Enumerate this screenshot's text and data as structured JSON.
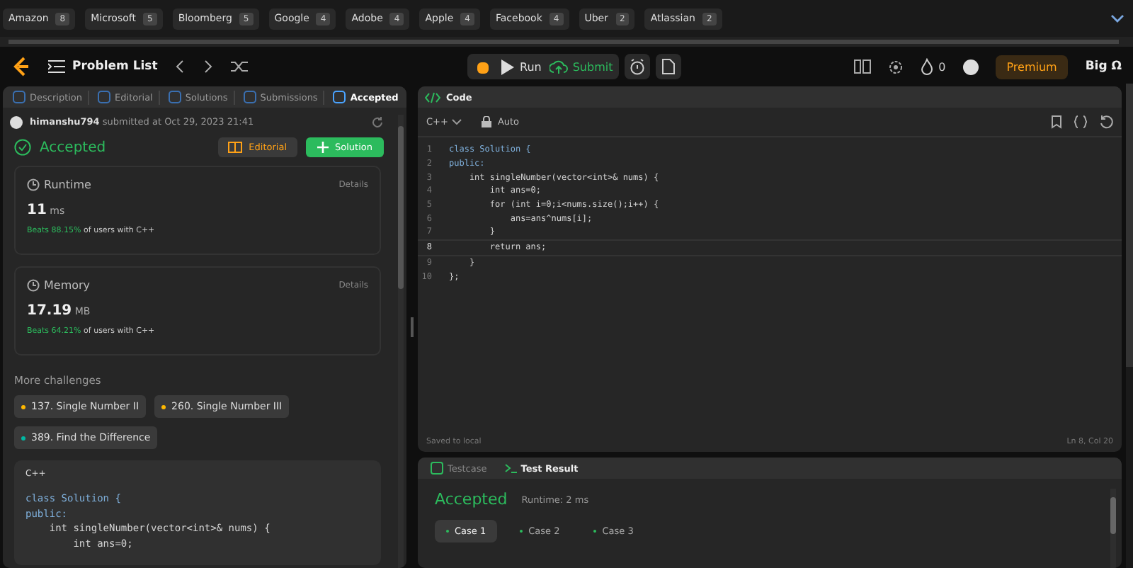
{
  "company_tags": [
    {
      "name": "Amazon",
      "count": "8"
    },
    {
      "name": "Microsoft",
      "count": "5"
    },
    {
      "name": "Bloomberg",
      "count": "5"
    },
    {
      "name": "Google",
      "count": "4"
    },
    {
      "name": "Adobe",
      "count": "4"
    },
    {
      "name": "Apple",
      "count": "4"
    },
    {
      "name": "Facebook",
      "count": "4"
    },
    {
      "name": "Uber",
      "count": "2"
    },
    {
      "name": "Atlassian",
      "count": "2"
    }
  ],
  "navbar": {
    "problem_list": "Problem List",
    "run": "Run",
    "submit": "Submit",
    "streak": "0",
    "premium": "Premium",
    "user": "Big Ω"
  },
  "left_tabs": [
    {
      "label": "Description",
      "selected": false
    },
    {
      "label": "Editorial",
      "selected": false
    },
    {
      "label": "Solutions",
      "selected": false
    },
    {
      "label": "Submissions",
      "selected": false
    },
    {
      "label": "Accepted",
      "selected": true
    }
  ],
  "submission": {
    "user": "himanshu794",
    "submitted": "submitted at Oct 29, 2023 21:41",
    "status": "Accepted",
    "editorial_button": "Editorial",
    "solution_button": "Solution"
  },
  "metrics": [
    {
      "title": "Runtime",
      "details": "Details",
      "value": "11",
      "unit": "ms",
      "beats": "Beats 88.15%",
      "suffix": "of users with C++"
    },
    {
      "title": "Memory",
      "details": "Details",
      "value": "17.19",
      "unit": "MB",
      "beats": "Beats 64.21%",
      "suffix": "of users with C++"
    }
  ],
  "more_challenges": {
    "heading": "More challenges",
    "items": [
      {
        "label": "137. Single Number II",
        "color": "#ffb800"
      },
      {
        "label": "260. Single Number III",
        "color": "#ffb800"
      },
      {
        "label": "389. Find the Difference",
        "color": "#00b8a3"
      }
    ]
  },
  "snippet": {
    "language": "C++",
    "lines": [
      "class Solution {",
      "public:",
      "    int singleNumber(vector<int>& nums) {",
      "        int ans=0;"
    ]
  },
  "code_panel": {
    "title": "Code",
    "language": "C++",
    "mode": "Auto",
    "status": "Saved to local",
    "cursor": "Ln 8, Col 20",
    "lines": [
      {
        "number": "1",
        "text": "class Solution {",
        "current": false
      },
      {
        "number": "2",
        "text": "public:",
        "current": false
      },
      {
        "number": "3",
        "text": "    int singleNumber(vector<int>& nums) {",
        "current": false
      },
      {
        "number": "4",
        "text": "        int ans=0;",
        "current": false
      },
      {
        "number": "5",
        "text": "        for (int i=0;i<nums.size();i++) {",
        "current": false
      },
      {
        "number": "6",
        "text": "            ans=ans^nums[i];",
        "current": false
      },
      {
        "number": "7",
        "text": "        }",
        "current": false
      },
      {
        "number": "8",
        "text": "        return ans;",
        "current": true
      },
      {
        "number": "9",
        "text": "    }",
        "current": false
      },
      {
        "number": "10",
        "text": "};",
        "current": false
      }
    ]
  },
  "result_panel": {
    "tabs": [
      {
        "label": "Testcase",
        "selected": false
      },
      {
        "label": "Test Result",
        "selected": true
      }
    ],
    "status": "Accepted",
    "runtime": "Runtime: 2 ms",
    "cases": [
      {
        "label": "Case 1",
        "selected": true
      },
      {
        "label": "Case 2",
        "selected": false
      },
      {
        "label": "Case 3",
        "selected": false
      }
    ]
  }
}
